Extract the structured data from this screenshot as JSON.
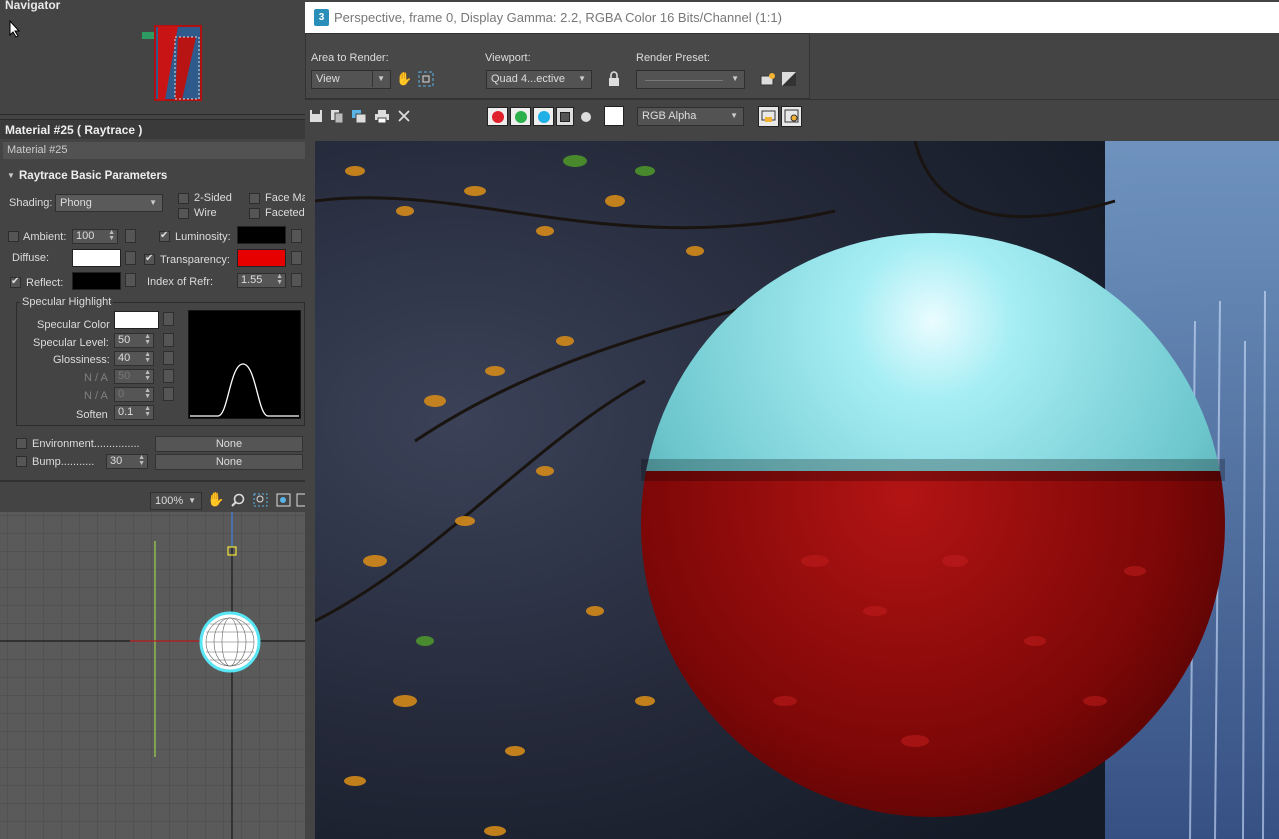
{
  "navigator": {
    "title": "Navigator"
  },
  "material": {
    "header": "Material #25  ( Raytrace )",
    "name": "Material #25",
    "rollout": "Raytrace Basic Parameters",
    "shading_label": "Shading:",
    "shading_value": "Phong",
    "two_sided": "2-Sided",
    "wire": "Wire",
    "face_map": "Face Ma",
    "faceted": "Faceted",
    "ambient_label": "Ambient:",
    "ambient_value": "100",
    "luminosity_label": "Luminosity:",
    "diffuse_label": "Diffuse:",
    "transparency_label": "Transparency:",
    "reflect_label": "Reflect:",
    "ior_label": "Index of Refr:",
    "ior_value": "1.55",
    "specular_group": "Specular Highlight",
    "specular_color_label": "Specular Color",
    "specular_level_label": "Specular Level:",
    "specular_level_value": "50",
    "glossiness_label": "Glossiness:",
    "glossiness_value": "40",
    "na1_label": "N / A",
    "na1_value": "50",
    "na2_label": "N / A",
    "na2_value": "0",
    "soften_label": "Soften",
    "soften_value": "0.1",
    "environment_label": "Environment...............",
    "environment_map": "None",
    "bump_label": "Bump...........",
    "bump_value": "30",
    "bump_map": "None",
    "colors": {
      "luminosity": "#000000",
      "diffuse": "#ffffff",
      "transparency": "#e60000",
      "reflect": "#000000",
      "specular": "#ffffff"
    }
  },
  "viewport": {
    "zoom": "100%"
  },
  "render_window": {
    "title": "Perspective, frame 0, Display Gamma: 2.2, RGBA Color 16 Bits/Channel (1:1)",
    "logo": "3",
    "area_label": "Area to Render:",
    "area_value": "View",
    "viewport_label": "Viewport:",
    "viewport_value": "Quad 4...ective",
    "preset_label": "Render Preset:",
    "preset_value": "",
    "channel_value": "RGB Alpha"
  }
}
